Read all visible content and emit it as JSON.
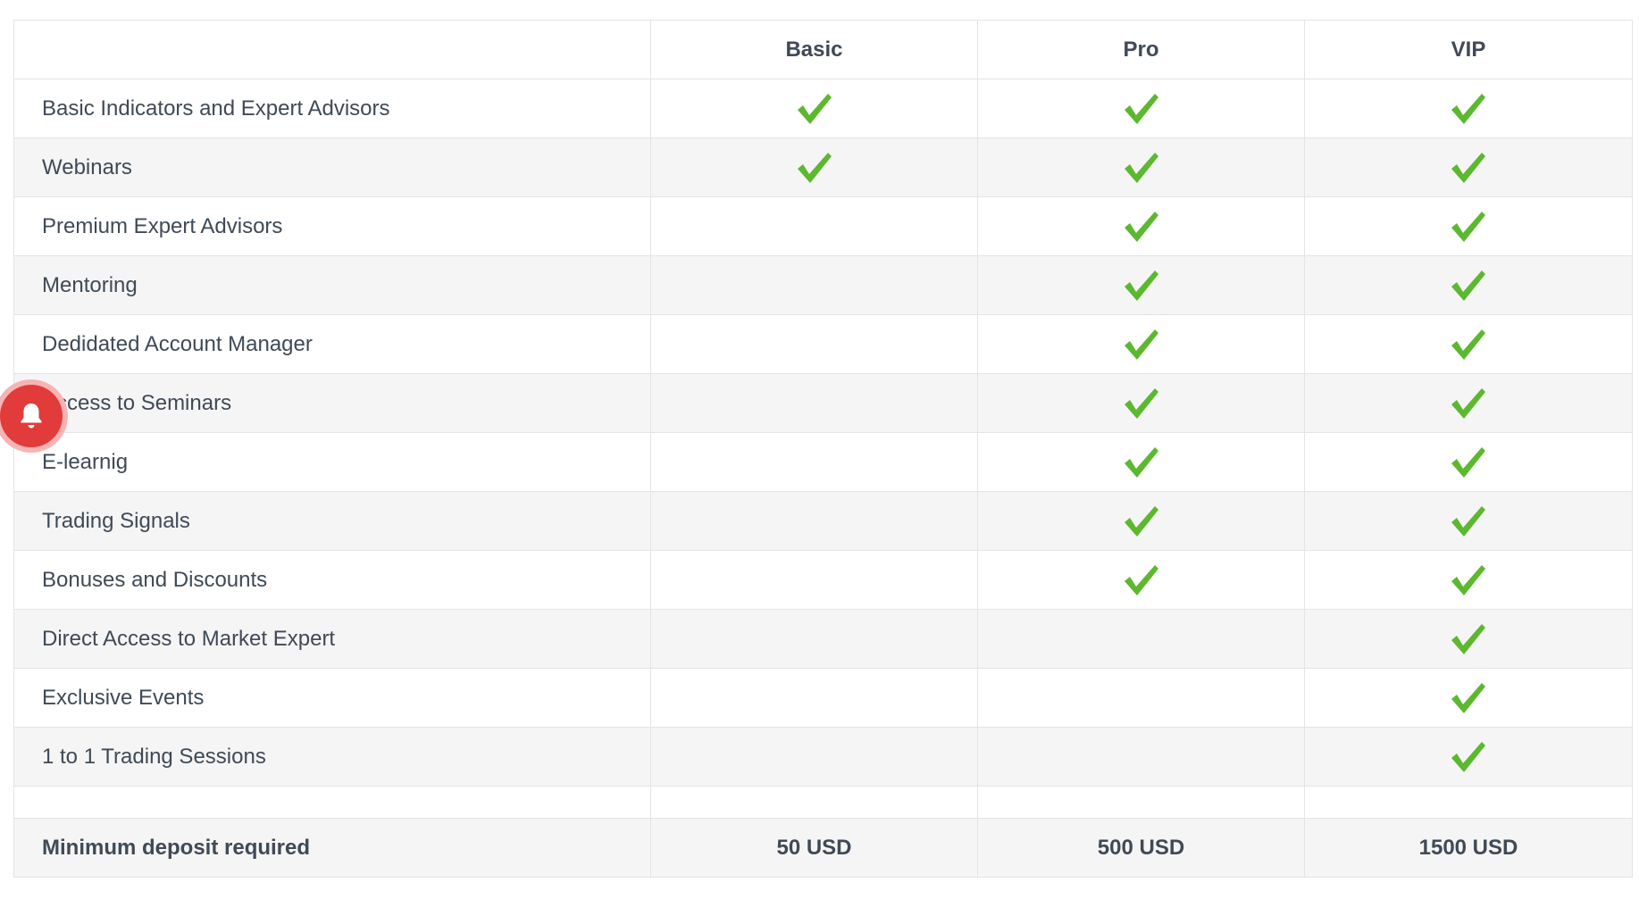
{
  "header": {
    "corner": "",
    "plans": [
      "Basic",
      "Pro",
      "VIP"
    ]
  },
  "rows": [
    {
      "feature": "Basic Indicators and Expert Advisors",
      "checks": [
        true,
        true,
        true
      ]
    },
    {
      "feature": "Webinars",
      "checks": [
        true,
        true,
        true
      ]
    },
    {
      "feature": "Premium Expert Advisors",
      "checks": [
        false,
        true,
        true
      ]
    },
    {
      "feature": "Mentoring",
      "checks": [
        false,
        true,
        true
      ]
    },
    {
      "feature": "Dedidated Account Manager",
      "checks": [
        false,
        true,
        true
      ]
    },
    {
      "feature": "Access to Seminars",
      "checks": [
        false,
        true,
        true
      ]
    },
    {
      "feature": "E-learnig",
      "checks": [
        false,
        true,
        true
      ]
    },
    {
      "feature": "Trading Signals",
      "checks": [
        false,
        true,
        true
      ]
    },
    {
      "feature": "Bonuses and Discounts",
      "checks": [
        false,
        true,
        true
      ]
    },
    {
      "feature": "Direct Access to Market Expert",
      "checks": [
        false,
        false,
        true
      ]
    },
    {
      "feature": "Exclusive Events",
      "checks": [
        false,
        false,
        true
      ]
    },
    {
      "feature": "1 to 1 Trading Sessions",
      "checks": [
        false,
        false,
        true
      ]
    }
  ],
  "deposit": {
    "label": "Minimum deposit required",
    "values": [
      "50 USD",
      "500 USD",
      "1500 USD"
    ]
  },
  "icons": {
    "check": "checkmark-icon",
    "notification": "bell-icon"
  },
  "colors": {
    "check": "#5cb82f",
    "bell": "#e23b3b",
    "row_alt": "#f5f5f5",
    "text": "#3f4a57"
  }
}
